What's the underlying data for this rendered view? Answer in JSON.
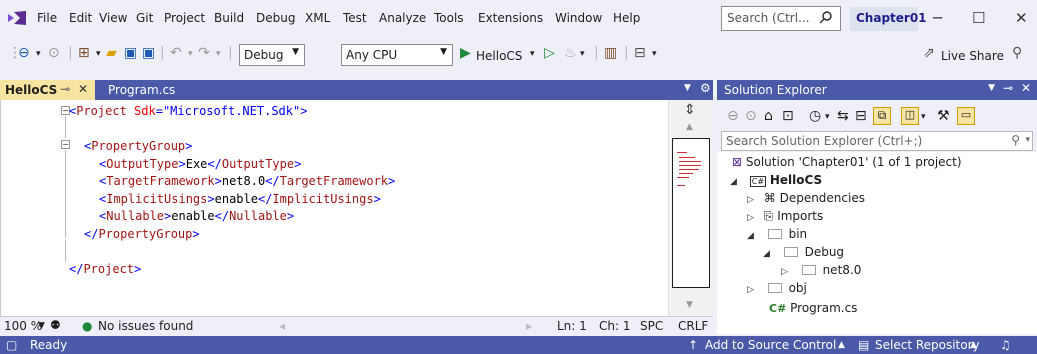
{
  "menu": {
    "items": [
      "File",
      "Edit",
      "View",
      "Git",
      "Project",
      "Build",
      "Debug",
      "XML",
      "Test",
      "Analyze",
      "Tools",
      "Extensions",
      "Window",
      "Help"
    ],
    "search_placeholder": "Search (Ctrl...",
    "solution_name": "Chapter01"
  },
  "toolbar": {
    "config": "Debug",
    "platform": "Any CPU",
    "run_target": "HelloCS",
    "live_share": "Live Share"
  },
  "tabs": {
    "active": "HelloCS",
    "inactive": "Program.cs"
  },
  "editor": {
    "lines": [
      {
        "indent": 0,
        "parts": [
          [
            "b",
            "<"
          ],
          [
            "t",
            "Project "
          ],
          [
            "a",
            "Sdk"
          ],
          [
            "b",
            "=\""
          ],
          [
            "v",
            "Microsoft.NET.Sdk"
          ],
          [
            "b",
            "\">"
          ]
        ]
      },
      {
        "indent": 0,
        "parts": []
      },
      {
        "indent": 1,
        "parts": [
          [
            "b",
            "<"
          ],
          [
            "t",
            "PropertyGroup"
          ],
          [
            "b",
            ">"
          ]
        ]
      },
      {
        "indent": 2,
        "parts": [
          [
            "b",
            "<"
          ],
          [
            "t",
            "OutputType"
          ],
          [
            "b",
            ">"
          ],
          [
            "x",
            "Exe"
          ],
          [
            "b",
            "</"
          ],
          [
            "t",
            "OutputType"
          ],
          [
            "b",
            ">"
          ]
        ]
      },
      {
        "indent": 2,
        "parts": [
          [
            "b",
            "<"
          ],
          [
            "t",
            "TargetFramework"
          ],
          [
            "b",
            ">"
          ],
          [
            "x",
            "net8.0"
          ],
          [
            "b",
            "</"
          ],
          [
            "t",
            "TargetFramework"
          ],
          [
            "b",
            ">"
          ]
        ]
      },
      {
        "indent": 2,
        "parts": [
          [
            "b",
            "<"
          ],
          [
            "t",
            "ImplicitUsings"
          ],
          [
            "b",
            ">"
          ],
          [
            "x",
            "enable"
          ],
          [
            "b",
            "</"
          ],
          [
            "t",
            "ImplicitUsings"
          ],
          [
            "b",
            ">"
          ]
        ]
      },
      {
        "indent": 2,
        "parts": [
          [
            "b",
            "<"
          ],
          [
            "t",
            "Nullable"
          ],
          [
            "b",
            ">"
          ],
          [
            "x",
            "enable"
          ],
          [
            "b",
            "</"
          ],
          [
            "t",
            "Nullable"
          ],
          [
            "b",
            ">"
          ]
        ]
      },
      {
        "indent": 1,
        "parts": [
          [
            "b",
            "</"
          ],
          [
            "t",
            "PropertyGroup"
          ],
          [
            "b",
            ">"
          ]
        ]
      },
      {
        "indent": 0,
        "parts": []
      },
      {
        "indent": 0,
        "parts": [
          [
            "b",
            "</"
          ],
          [
            "t",
            "Project"
          ],
          [
            "b",
            ">"
          ]
        ]
      }
    ],
    "zoom": "100 %",
    "issues": "No issues found",
    "ln": "Ln: 1",
    "ch": "Ch: 1",
    "spc": "SPC",
    "crlf": "CRLF"
  },
  "solution_explorer": {
    "title": "Solution Explorer",
    "search_placeholder": "Search Solution Explorer (Ctrl+;)",
    "solution": "Solution 'Chapter01' (1 of 1 project)",
    "project": "HelloCS",
    "dependencies": "Dependencies",
    "imports": "Imports",
    "bin": "bin",
    "debug": "Debug",
    "net": "net8.0",
    "obj": "obj",
    "program": "Program.cs",
    "cs_badge": "C#"
  },
  "status": {
    "ready": "Ready",
    "add_source": "Add to Source Control",
    "select_repo": "Select Repository"
  },
  "colors": {
    "accent": "#4a59a8",
    "active_tab": "#f7e4a0",
    "tag": "#a31515",
    "attr": "#ff0000",
    "value": "#0000ff"
  }
}
